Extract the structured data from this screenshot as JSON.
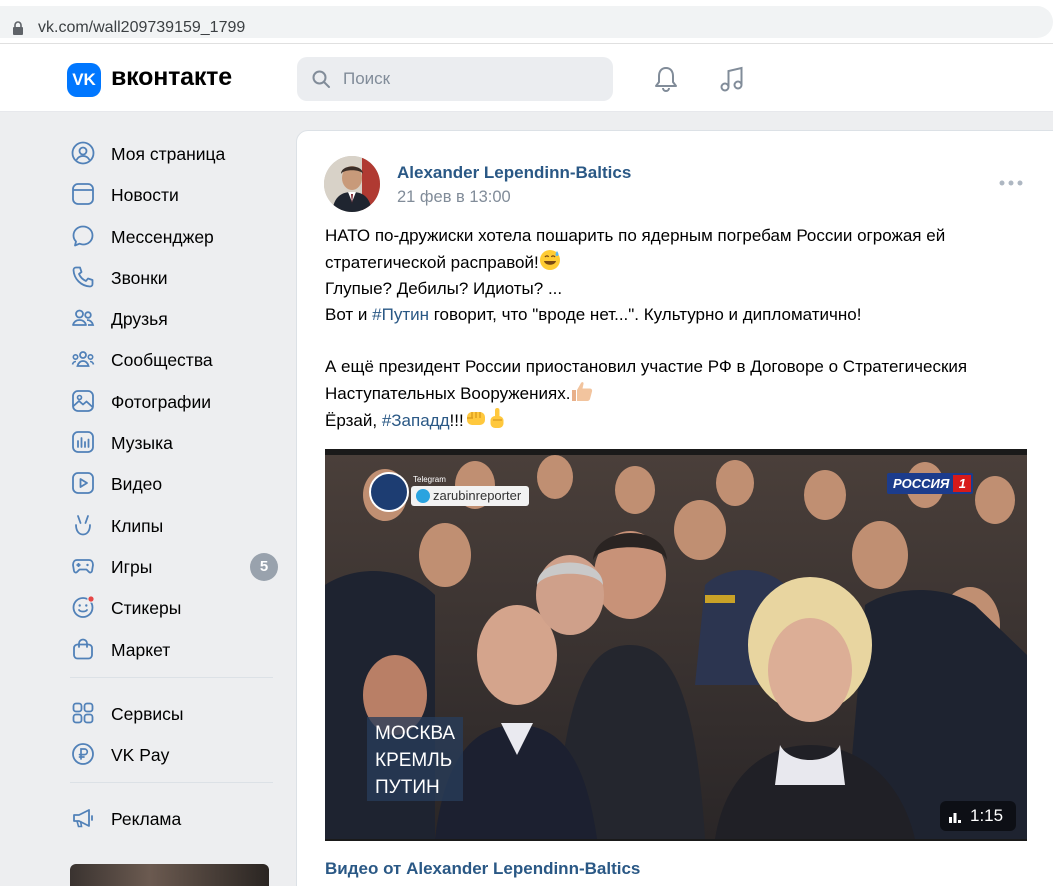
{
  "browser": {
    "url": "vk.com/wall209739159_1799"
  },
  "header": {
    "logo_text": "VK",
    "brand": "вконтакте",
    "search_placeholder": "Поиск"
  },
  "sidebar": {
    "items": [
      {
        "label": "Моя страница",
        "icon": "profile-icon"
      },
      {
        "label": "Новости",
        "icon": "news-icon"
      },
      {
        "label": "Мессенджер",
        "icon": "messenger-icon"
      },
      {
        "label": "Звонки",
        "icon": "phone-icon"
      },
      {
        "label": "Друзья",
        "icon": "friends-icon"
      },
      {
        "label": "Сообщества",
        "icon": "communities-icon"
      },
      {
        "label": "Фотографии",
        "icon": "photos-icon"
      },
      {
        "label": "Музыка",
        "icon": "music-chart-icon"
      },
      {
        "label": "Видео",
        "icon": "video-icon"
      },
      {
        "label": "Клипы",
        "icon": "clips-icon"
      },
      {
        "label": "Игры",
        "icon": "games-icon",
        "badge": "5"
      },
      {
        "label": "Стикеры",
        "icon": "stickers-icon"
      },
      {
        "label": "Маркет",
        "icon": "market-icon"
      }
    ],
    "items2": [
      {
        "label": "Сервисы",
        "icon": "services-icon"
      },
      {
        "label": "VK Pay",
        "icon": "vkpay-icon"
      }
    ],
    "items3": [
      {
        "label": "Реклама",
        "icon": "ads-icon"
      }
    ]
  },
  "post": {
    "author": "Alexander Lependinn-Baltics",
    "date": "21 фев в 13:00",
    "text": {
      "l1": "НАТО по-дружиски хотела пошарить по ядерным погребам России огрожая ей",
      "l2": "стратегической расправой!",
      "l3": "Глупые? Дебилы? Идиоты? ...",
      "l4a": "Вот и ",
      "l4tag": "#Путин",
      "l4b": " говорит, что \"вроде нет...\". Культурно и дипломатично!",
      "l5": "А ещё президент России приостановил участие РФ в Договоре о Стратегическия",
      "l6": "Наступательных Вооружениях.",
      "l7a": "Ёрзай, ",
      "l7tag": "#Западд",
      "l7b": "!!!"
    },
    "video": {
      "telegram_label": "Telegram",
      "telegram_channel": "zarubinreporter",
      "channel_logo": "РОССИЯ",
      "channel_number": "1",
      "caption_lines": [
        "МОСКВА",
        "КРЕМЛЬ",
        "ПУТИН"
      ],
      "duration": "1:15"
    },
    "video_source": "Видео от Alexander Lependinn-Baltics"
  },
  "colors": {
    "accent": "#0077ff",
    "link": "#2a5885",
    "muted": "#818c99",
    "background": "#edeef0"
  }
}
